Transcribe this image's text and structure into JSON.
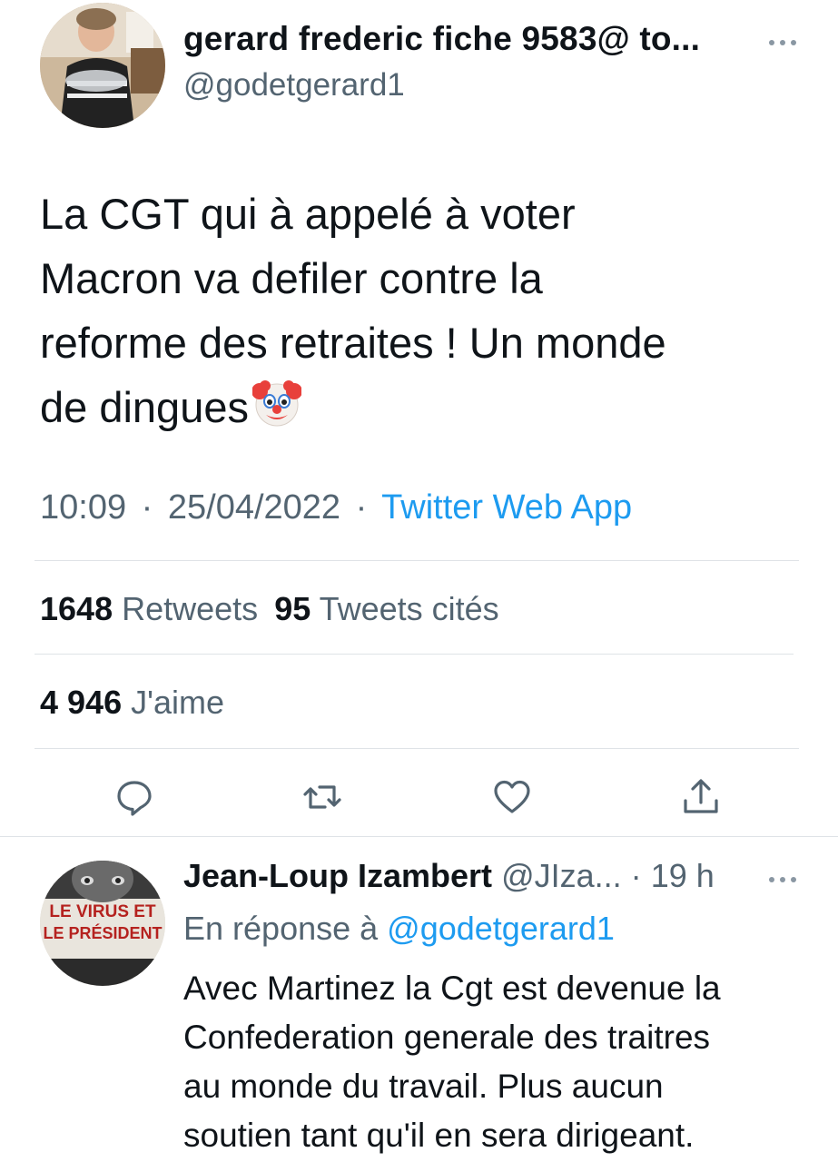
{
  "tweet": {
    "author_name": "gerard frederic fiche 9583@ to...",
    "author_handle": "@godetgerard1",
    "more_icon": "more-horizontal-icon",
    "text_lines": [
      "La CGT qui à appelé à voter",
      "Macron va defiler contre la",
      "reforme des retraites ! Un monde",
      "de dingues"
    ],
    "emoji": "clown-face-emoji",
    "time": "10:09",
    "date": "25/04/2022",
    "separator": "·",
    "source": "Twitter Web App",
    "retweets_count": "1648",
    "retweets_label": "Retweets",
    "quotes_count": "95",
    "quotes_label": "Tweets cités",
    "likes_count": "4 946",
    "likes_label": "J'aime",
    "actions": [
      "reply-icon",
      "retweet-icon",
      "like-icon",
      "share-icon"
    ]
  },
  "reply": {
    "author_name": "Jean-Loup Izambert",
    "author_handle": "@JIza...",
    "separator": "·",
    "time_ago": "19 h",
    "reply_to_prefix": "En réponse à",
    "reply_to_handle": "@godetgerard1",
    "avatar_text_line1": "LE VIRUS ET",
    "avatar_text_line2": "LE PRÉSIDENT",
    "text_lines": [
      "Avec Martinez la Cgt est devenue la",
      "Confederation generale des traitres",
      "au monde du travail. Plus aucun",
      "soutien tant qu'il en sera dirigeant."
    ]
  },
  "colors": {
    "link_blue": "#1d9bf0",
    "secondary_gray": "#536471",
    "text_black": "#0f1419",
    "divider": "#dfe3e7"
  }
}
